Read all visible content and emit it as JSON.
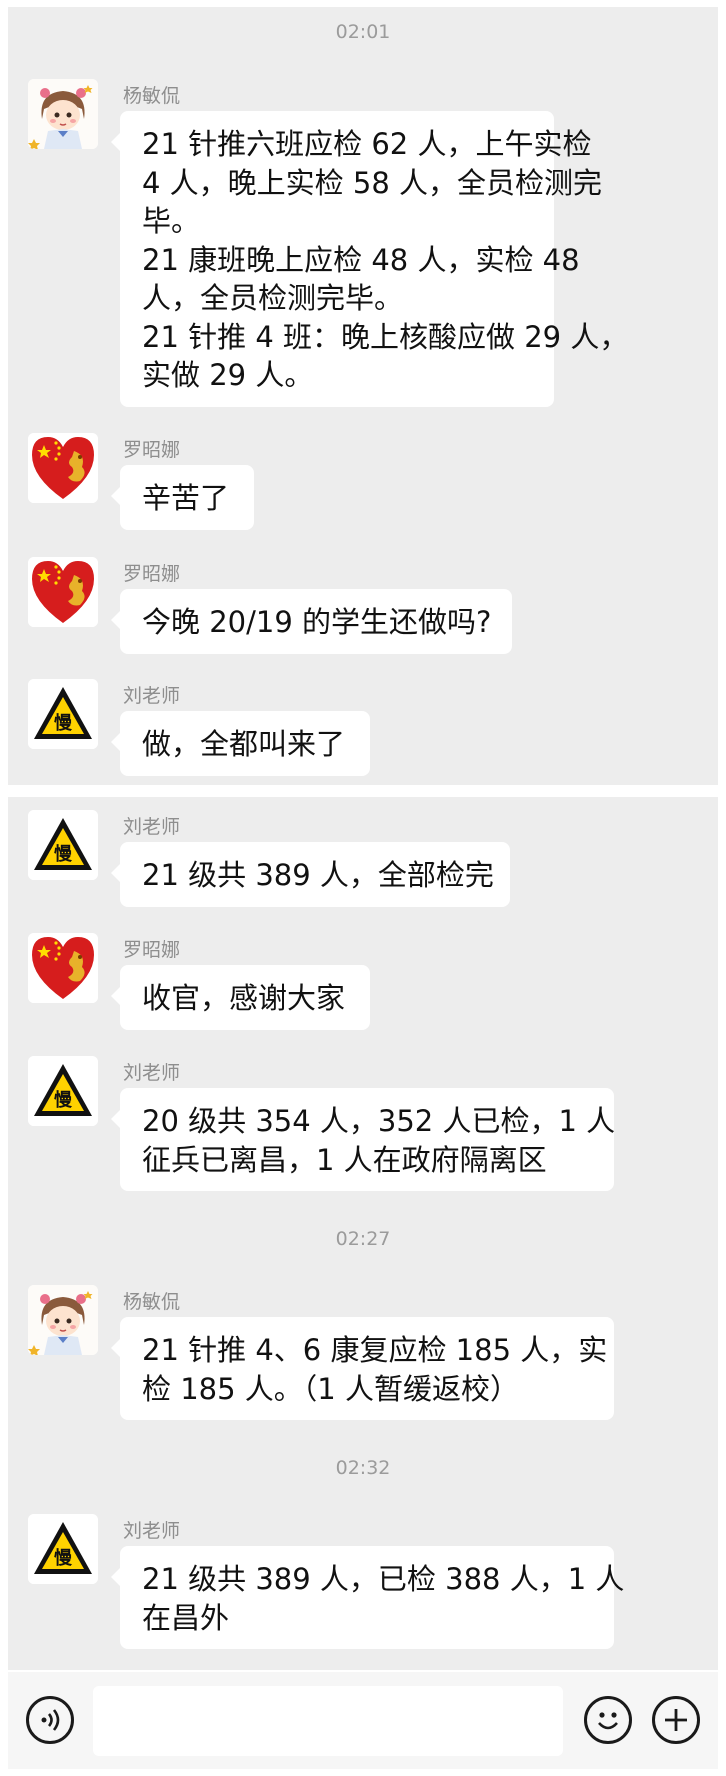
{
  "panel1": {
    "time": "02:01",
    "messages": [
      {
        "sender": "杨敏侃",
        "avatar": "cartoon-girl-avatar",
        "lines": [
          "21 针推六班应检 62 人，上午实检",
          "4 人，晚上实检 58 人，全员检测完",
          "毕。",
          "21 康班晚上应检 48 人，实检 48",
          "人，全员检测完毕。",
          "21 针推 4 班：晚上核酸应做 29 人，",
          "实做 29 人。"
        ]
      },
      {
        "sender": "罗昭娜",
        "avatar": "flag-heart-avatar",
        "lines": [
          "辛苦了"
        ]
      },
      {
        "sender": "罗昭娜",
        "avatar": "flag-heart-avatar",
        "lines": [
          "今晚 20/19 的学生还做吗?"
        ]
      },
      {
        "sender": "刘老师",
        "avatar": "slow-sign-avatar",
        "lines": [
          "做，全都叫来了"
        ]
      }
    ]
  },
  "panel2": {
    "times": [
      "02:27",
      "02:32"
    ],
    "messages": [
      {
        "sender": "刘老师",
        "avatar": "slow-sign-avatar",
        "lines": [
          "21 级共 389 人，全部检完"
        ]
      },
      {
        "sender": "罗昭娜",
        "avatar": "flag-heart-avatar",
        "lines": [
          "收官，感谢大家"
        ]
      },
      {
        "sender": "刘老师",
        "avatar": "slow-sign-avatar",
        "lines": [
          "20 级共 354 人，352 人已检，1 人",
          "征兵已离昌，1 人在政府隔离区"
        ]
      },
      {
        "sender": "杨敏侃",
        "avatar": "cartoon-girl-avatar",
        "lines": [
          "21 针推 4、6 康复应检 185 人，实",
          "检 185 人。（1 人暂缓返校）"
        ]
      },
      {
        "sender": "刘老师",
        "avatar": "slow-sign-avatar",
        "lines": [
          "21 级共 389 人，已检 388 人，1 人",
          "在昌外"
        ]
      }
    ]
  },
  "slow_sign_text": "慢",
  "input_bar": {
    "voice_icon": "voice-icon",
    "emoji_icon": "emoji-icon",
    "plus_icon": "plus-icon"
  },
  "colors": {
    "background": "#ededed",
    "bubble": "#ffffff",
    "meta_text": "#8e8e8e"
  }
}
